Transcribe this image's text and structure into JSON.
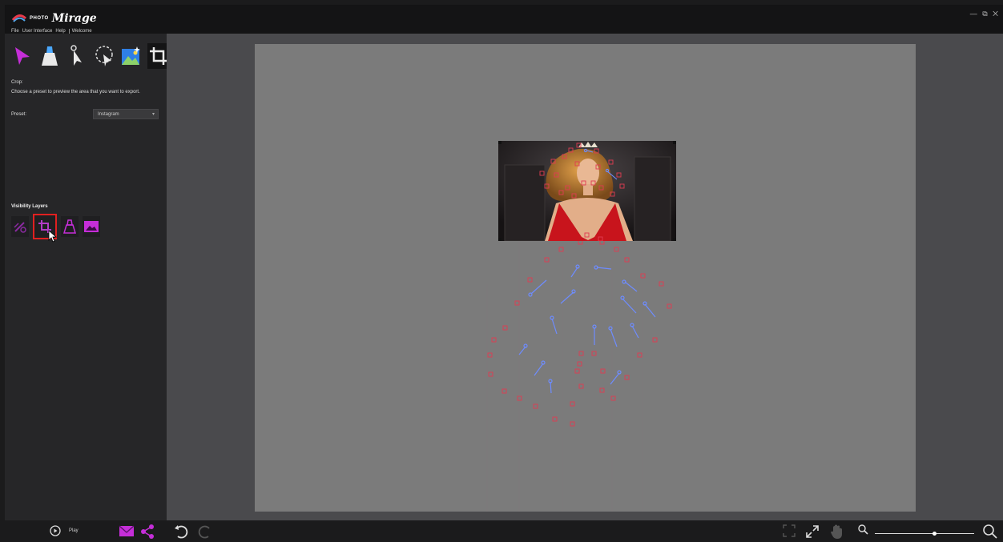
{
  "app": {
    "logo_small": "PHOTO",
    "logo_big": "Mirage",
    "window_controls": "— ⧉ ✕"
  },
  "menu": [
    "File",
    "User Interface",
    "Help",
    "Welcome"
  ],
  "tools": {
    "items": [
      {
        "name": "select-tool-icon",
        "active": false
      },
      {
        "name": "freeze-mask-tool-icon",
        "active": false
      },
      {
        "name": "anchor-tool-icon",
        "active": false
      },
      {
        "name": "lasso-select-tool-icon",
        "active": false
      },
      {
        "name": "overlay-tool-icon",
        "active": false
      },
      {
        "name": "crop-tool-icon",
        "active": true
      }
    ]
  },
  "crop": {
    "title": "Crop:",
    "description": "Choose a preset to preview the area that you want to export.",
    "preset_label": "Preset:",
    "preset_value": "Instagram"
  },
  "visibility": {
    "title": "Visibility Layers",
    "layers": [
      "motion-layer-icon",
      "crop-layer-icon",
      "mask-layer-icon",
      "image-layer-icon"
    ],
    "selected": "crop-layer-icon"
  },
  "bottom": {
    "play_label": "Play",
    "zoom_level": 0.6
  },
  "colors": {
    "accent": "#c52ed8",
    "selection_outline": "#e02020",
    "anchor": "#e03c52",
    "motion_arrow": "#6e8cff"
  }
}
